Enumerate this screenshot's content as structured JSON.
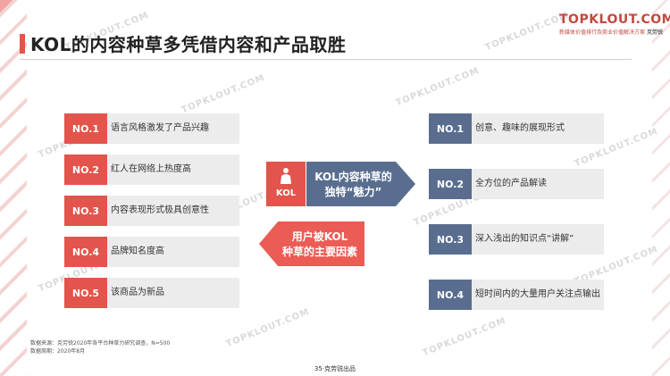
{
  "title": "KOL的内容种草多凭借内容和产品取胜",
  "logo": {
    "brand": "TOPKLOUT.COM",
    "tagline": "新媒体价值排行及商业价值解决方案",
    "cn_name": "克劳锐"
  },
  "watermark": "TOPKLOUT.COM",
  "left_items": [
    {
      "badge": "NO.1",
      "text": "语言风格激发了产品兴趣"
    },
    {
      "badge": "NO.2",
      "text": "红人在网络上热度高"
    },
    {
      "badge": "NO.3",
      "text": "内容表现形式极具创意性"
    },
    {
      "badge": "NO.4",
      "text": "品牌知名度高"
    },
    {
      "badge": "NO.5",
      "text": "该商品为新品"
    }
  ],
  "right_items": [
    {
      "badge": "NO.1",
      "text": "创意、趣味的展现形式"
    },
    {
      "badge": "NO.2",
      "text": "全方位的产品解读"
    },
    {
      "badge": "NO.3",
      "text": "深入浅出的知识点“讲解”"
    },
    {
      "badge": "NO.4",
      "text": "短时间内的大量用户关注点输出"
    }
  ],
  "center": {
    "kol_label": "KOL",
    "blue_line1": "KOL内容种草的",
    "blue_line2": "独特“魅力”",
    "red_line1": "用户被KOL",
    "red_line2": "种草的主要因素"
  },
  "footer": {
    "source": "数据来源：克劳锐2020年各平台种草力研究调查，N=500",
    "period": "数据周期：2020年8月"
  },
  "page_label": "35·克劳锐出品",
  "colors": {
    "red": "#e2544c",
    "blue": "#596e8f",
    "row_bg": "#ececec"
  }
}
